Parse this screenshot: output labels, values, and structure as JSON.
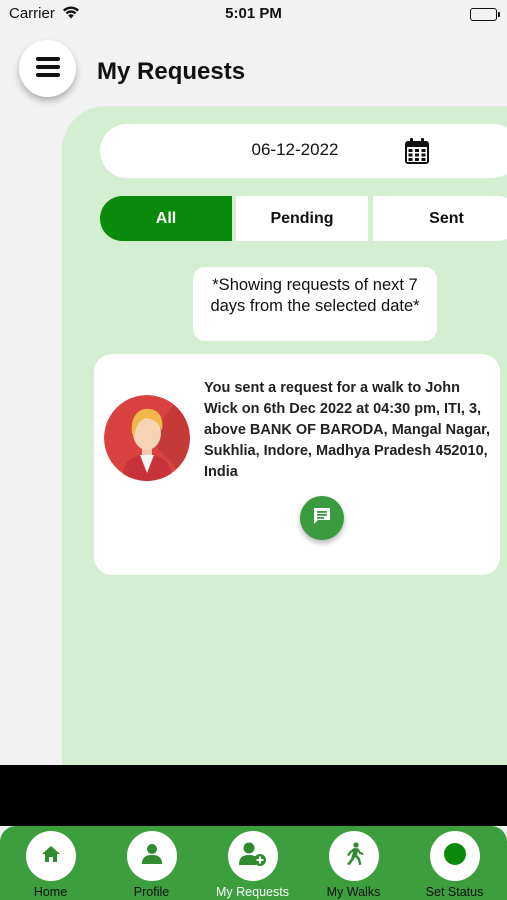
{
  "status_bar": {
    "carrier": "Carrier",
    "time": "5:01 PM"
  },
  "header": {
    "title": "My Requests"
  },
  "date_filter": {
    "value": "06-12-2022"
  },
  "tabs": [
    {
      "label": "All",
      "active": true
    },
    {
      "label": "Pending",
      "active": false
    },
    {
      "label": "Sent",
      "active": false
    }
  ],
  "notice": "*Showing requests of next 7 days from the selected date*",
  "request": {
    "message": "You sent a request for a walk to John Wick on 6th Dec 2022 at 04:30 pm, ITI, 3, above BANK OF BARODA, Mangal Nagar, Sukhlia, Indore, Madhya Pradesh 452010, India"
  },
  "bottom_nav": {
    "items": [
      {
        "label": "Home",
        "icon": "home-icon"
      },
      {
        "label": "Profile",
        "icon": "profile-icon"
      },
      {
        "label": "My Requests",
        "icon": "requests-icon",
        "active": true
      },
      {
        "label": "My Walks",
        "icon": "walk-icon"
      },
      {
        "label": "Set Status",
        "icon": "status-dot-icon"
      }
    ]
  },
  "colors": {
    "primary_green": "#0a8a0a",
    "nav_green": "#3c9e3c",
    "panel_green": "#d3eed1",
    "background": "#f2f2f2"
  }
}
